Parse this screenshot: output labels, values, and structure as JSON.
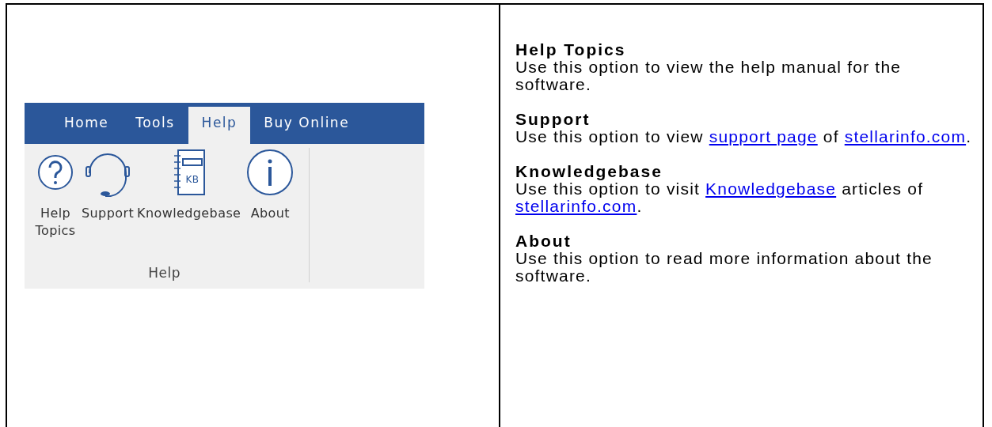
{
  "ribbon": {
    "tabs": [
      {
        "label": "Home",
        "selected": false
      },
      {
        "label": "Tools",
        "selected": false
      },
      {
        "label": "Help",
        "selected": true
      },
      {
        "label": "Buy Online",
        "selected": false
      }
    ],
    "buttons": [
      {
        "label": "Help Topics",
        "kind": "question"
      },
      {
        "label": "Support",
        "kind": "headset"
      },
      {
        "label": "Knowledgebase",
        "kind": "notebook",
        "icon_text": "KB"
      },
      {
        "label": "About",
        "kind": "info"
      }
    ],
    "group_label": "Help"
  },
  "topics": [
    {
      "title": "Help Topics",
      "parts": [
        {
          "text": "Use this option to view the help manual for the software.",
          "link": false
        }
      ]
    },
    {
      "title": "Support",
      "parts": [
        {
          "text": "Use this option to view ",
          "link": false
        },
        {
          "text": "support page",
          "link": true
        },
        {
          "text": " of ",
          "link": false
        },
        {
          "text": "stellarinfo.com",
          "link": true
        },
        {
          "text": ".",
          "link": false
        }
      ]
    },
    {
      "title": "Knowledgebase",
      "parts": [
        {
          "text": "Use this option to visit ",
          "link": false
        },
        {
          "text": "Knowledgebase",
          "link": true
        },
        {
          "text": " articles of ",
          "link": false
        },
        {
          "text": "stellarinfo.com",
          "link": true
        },
        {
          "text": ".",
          "link": false
        }
      ]
    },
    {
      "title": "About",
      "parts": [
        {
          "text": "Use this option to read more information about the software.",
          "link": false
        }
      ]
    }
  ]
}
